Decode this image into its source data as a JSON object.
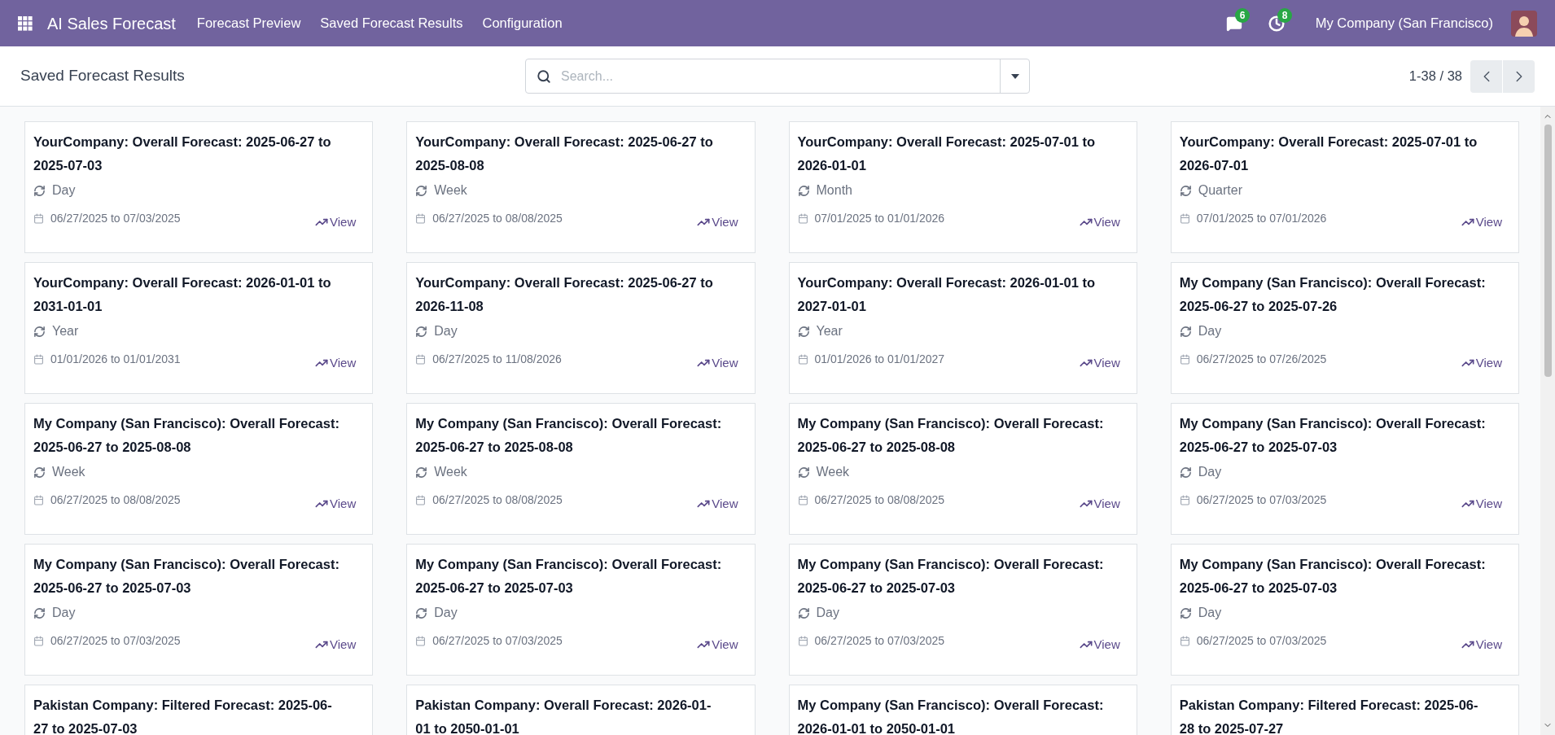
{
  "navbar": {
    "app_name": "AI Sales Forecast",
    "menu": [
      {
        "label": "Forecast Preview"
      },
      {
        "label": "Saved Forecast Results"
      },
      {
        "label": "Configuration"
      }
    ],
    "messages_count": "6",
    "activities_count": "8",
    "company": "My Company (San Francisco)"
  },
  "control_panel": {
    "title": "Saved Forecast Results",
    "search": {
      "placeholder": "Search..."
    },
    "pager": "1-38 / 38"
  },
  "cards": [
    {
      "title": "YourCompany: Overall Forecast: 2025-06-27 to 2025-07-03",
      "period": "Day",
      "dates": "06/27/2025 to 07/03/2025",
      "action": "View"
    },
    {
      "title": "YourCompany: Overall Forecast: 2025-06-27 to 2025-08-08",
      "period": "Week",
      "dates": "06/27/2025 to 08/08/2025",
      "action": "View"
    },
    {
      "title": "YourCompany: Overall Forecast: 2025-07-01 to 2026-01-01",
      "period": "Month",
      "dates": "07/01/2025 to 01/01/2026",
      "action": "View"
    },
    {
      "title": "YourCompany: Overall Forecast: 2025-07-01 to 2026-07-01",
      "period": "Quarter",
      "dates": "07/01/2025 to 07/01/2026",
      "action": "View"
    },
    {
      "title": "YourCompany: Overall Forecast: 2026-01-01 to 2031-01-01",
      "period": "Year",
      "dates": "01/01/2026 to 01/01/2031",
      "action": "View"
    },
    {
      "title": "YourCompany: Overall Forecast: 2025-06-27 to 2026-11-08",
      "period": "Day",
      "dates": "06/27/2025 to 11/08/2026",
      "action": "View"
    },
    {
      "title": "YourCompany: Overall Forecast: 2026-01-01 to 2027-01-01",
      "period": "Year",
      "dates": "01/01/2026 to 01/01/2027",
      "action": "View"
    },
    {
      "title": "My Company (San Francisco): Overall Forecast: 2025-06-27 to 2025-07-26",
      "period": "Day",
      "dates": "06/27/2025 to 07/26/2025",
      "action": "View"
    },
    {
      "title": "My Company (San Francisco): Overall Forecast: 2025-06-27 to 2025-08-08",
      "period": "Week",
      "dates": "06/27/2025 to 08/08/2025",
      "action": "View"
    },
    {
      "title": "My Company (San Francisco): Overall Forecast: 2025-06-27 to 2025-08-08",
      "period": "Week",
      "dates": "06/27/2025 to 08/08/2025",
      "action": "View"
    },
    {
      "title": "My Company (San Francisco): Overall Forecast: 2025-06-27 to 2025-08-08",
      "period": "Week",
      "dates": "06/27/2025 to 08/08/2025",
      "action": "View"
    },
    {
      "title": "My Company (San Francisco): Overall Forecast: 2025-06-27 to 2025-07-03",
      "period": "Day",
      "dates": "06/27/2025 to 07/03/2025",
      "action": "View"
    },
    {
      "title": "My Company (San Francisco): Overall Forecast: 2025-06-27 to 2025-07-03",
      "period": "Day",
      "dates": "06/27/2025 to 07/03/2025",
      "action": "View"
    },
    {
      "title": "My Company (San Francisco): Overall Forecast: 2025-06-27 to 2025-07-03",
      "period": "Day",
      "dates": "06/27/2025 to 07/03/2025",
      "action": "View"
    },
    {
      "title": "My Company (San Francisco): Overall Forecast: 2025-06-27 to 2025-07-03",
      "period": "Day",
      "dates": "06/27/2025 to 07/03/2025",
      "action": "View"
    },
    {
      "title": "My Company (San Francisco): Overall Forecast: 2025-06-27 to 2025-07-03",
      "period": "Day",
      "dates": "06/27/2025 to 07/03/2025",
      "action": "View"
    },
    {
      "title": "Pakistan Company: Filtered Forecast: 2025-06-27 to 2025-07-03"
    },
    {
      "title": "Pakistan Company: Overall Forecast: 2026-01-01 to 2050-01-01"
    },
    {
      "title": "My Company (San Francisco): Overall Forecast: 2026-01-01 to 2050-01-01"
    },
    {
      "title": "Pakistan Company: Filtered Forecast: 2025-06-28 to 2025-07-27"
    }
  ]
}
